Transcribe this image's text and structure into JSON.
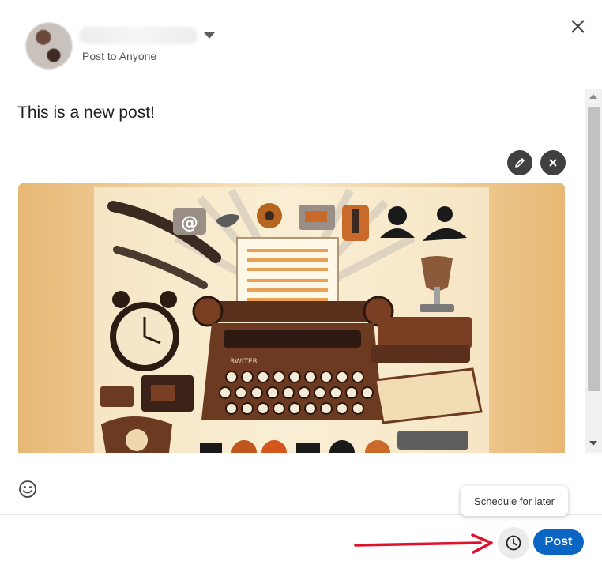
{
  "composer": {
    "audience_label": "Post to Anyone",
    "post_text": "This is a new post!",
    "tooltip": "Schedule for later",
    "post_button": "Post"
  },
  "icons": {
    "close": "close-icon",
    "edit": "pencil-icon",
    "remove": "close-icon",
    "emoji": "smiley-icon",
    "schedule": "clock-icon"
  },
  "image": {
    "description_label": "WRITER"
  },
  "colors": {
    "primary": "#0a66c2",
    "annotation_arrow": "#e0112b",
    "icon_button_bg": "#404040"
  }
}
